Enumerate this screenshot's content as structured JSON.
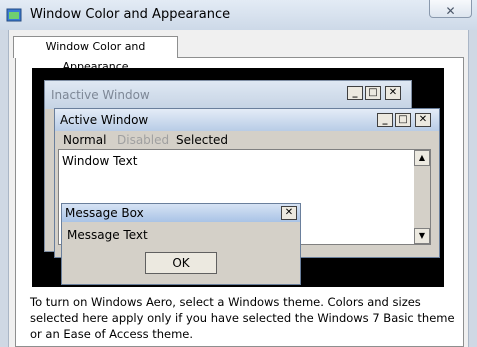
{
  "window": {
    "title": "Window Color and Appearance",
    "close_label": "✕"
  },
  "tab": {
    "label": "Window Color and Appearance"
  },
  "preview": {
    "inactive_window": {
      "title": "Inactive Window"
    },
    "active_window": {
      "title": "Active Window",
      "menu": {
        "normal": "Normal",
        "disabled": "Disabled",
        "selected": "Selected"
      },
      "window_text": "Window Text"
    },
    "message_box": {
      "title": "Message Box",
      "text": "Message Text",
      "ok_label": "OK"
    },
    "caption_buttons": {
      "minimize": "_",
      "maximize": "□",
      "close": "✕"
    }
  },
  "description": "To turn on Windows Aero, select a Windows theme.  Colors and sizes selected here apply only if you have selected the Windows 7 Basic theme or an Ease of Access theme.",
  "colors": {
    "selected_highlight": "#3399ff",
    "active_title": "#b8cce6",
    "inactive_title": "#c5d3e4"
  }
}
